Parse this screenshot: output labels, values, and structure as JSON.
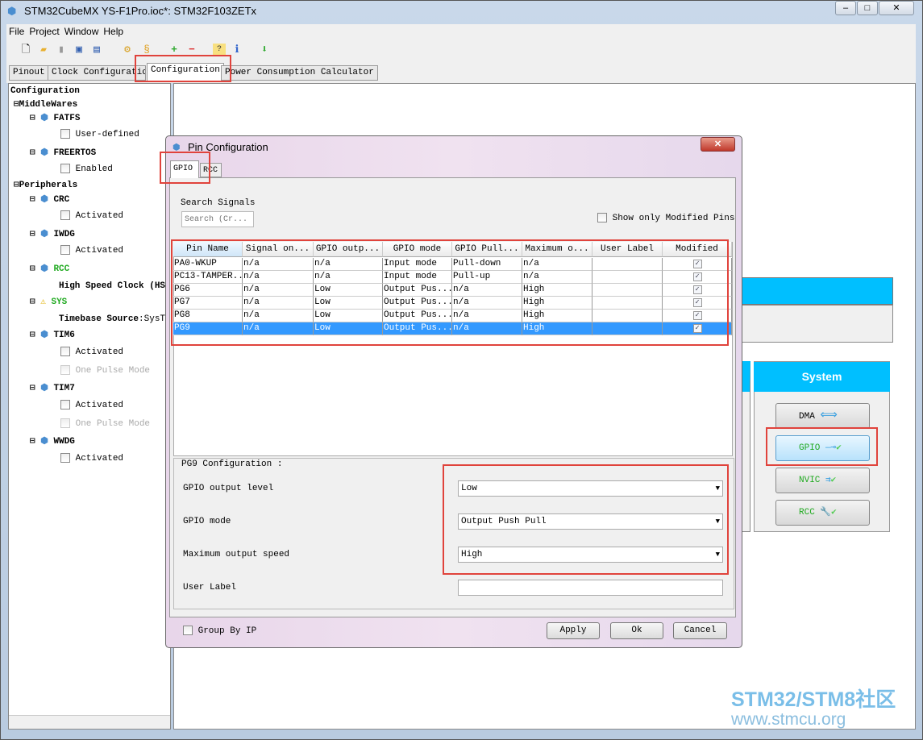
{
  "window": {
    "title": "STM32CubeMX YS-F1Pro.ioc*: STM32F103ZETx",
    "min": "–",
    "max": "□",
    "close": "✕"
  },
  "menu": [
    "File",
    "Project",
    "Window",
    "Help"
  ],
  "tabs": [
    "Pinout",
    "Clock Configuration",
    "Configuration",
    "Power Consumption Calculator"
  ],
  "active_tab": "Configuration",
  "tree": {
    "root": "Configuration",
    "middlewares": "MiddleWares",
    "fatfs": "FATFS",
    "fatfs_opt": "User-defined",
    "freertos": "FREERTOS",
    "freertos_opt": "Enabled",
    "peripherals": "Peripherals",
    "crc": "CRC",
    "crc_opt": "Activated",
    "iwdg": "IWDG",
    "iwdg_opt": "Activated",
    "rcc": "RCC",
    "rcc_opt": "High Speed Clock (HSE)",
    "sys": "SYS",
    "sys_opt_b": "Timebase Source",
    "sys_opt": ":SysTick",
    "tim6": "TIM6",
    "tim6_opt1": "Activated",
    "tim6_opt2": "One Pulse Mode",
    "tim7": "TIM7",
    "tim7_opt1": "Activated",
    "tim7_opt2": "One Pulse Mode",
    "wwdg": "WWDG",
    "wwdg_opt": "Activated",
    "ok_color": "#22aa22"
  },
  "system_panel": {
    "title": "System",
    "buttons": [
      "DMA",
      "GPIO",
      "NVIC",
      "RCC"
    ],
    "selected": "GPIO",
    "header_color": "#00bfff"
  },
  "dialog": {
    "title": "Pin Configuration",
    "tabs": [
      "GPIO",
      "RCC"
    ],
    "search_label": "Search Signals",
    "search_placeholder": "Search (Cr...",
    "show_modified": "Show only Modified Pins",
    "columns": [
      "Pin Name",
      "Signal on...",
      "GPIO outp...",
      "GPIO mode",
      "GPIO Pull...",
      "Maximum o...",
      "User Label",
      "Modified"
    ],
    "rows": [
      [
        "PA0-WKUP",
        "n/a",
        "n/a",
        "Input mode",
        "Pull-down",
        "n/a",
        "",
        true
      ],
      [
        "PC13-TAMPER...",
        "n/a",
        "n/a",
        "Input mode",
        "Pull-up",
        "n/a",
        "",
        true
      ],
      [
        "PG6",
        "n/a",
        "Low",
        "Output Pus...",
        "n/a",
        "High",
        "",
        true
      ],
      [
        "PG7",
        "n/a",
        "Low",
        "Output Pus...",
        "n/a",
        "High",
        "",
        true
      ],
      [
        "PG8",
        "n/a",
        "Low",
        "Output Pus...",
        "n/a",
        "High",
        "",
        true
      ],
      [
        "PG9",
        "n/a",
        "Low",
        "Output Pus...",
        "n/a",
        "High",
        "",
        true
      ]
    ],
    "selected_row": 5,
    "config": {
      "title": "PG9 Configuration :",
      "output_level_label": "GPIO output level",
      "output_level": "Low",
      "mode_label": "GPIO mode",
      "mode": "Output Push Pull",
      "speed_label": "Maximum output speed",
      "speed": "High",
      "user_label_label": "User Label",
      "user_label": ""
    },
    "group_by_ip": "Group By IP",
    "apply": "Apply",
    "ok": "Ok",
    "cancel": "Cancel"
  },
  "watermark": {
    "line1": "STM32/STM8社区",
    "line2": "www.stmcu.org"
  }
}
